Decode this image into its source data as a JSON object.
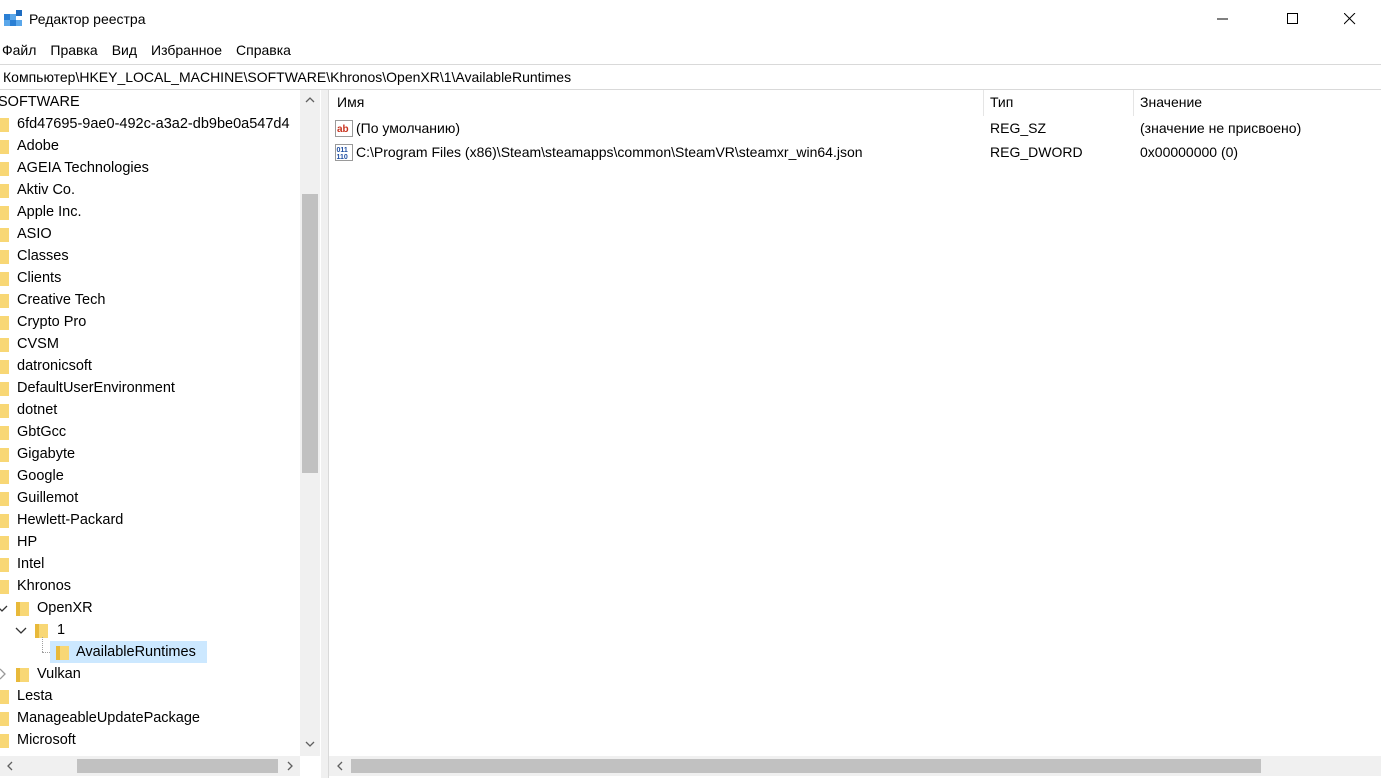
{
  "window": {
    "title": "Редактор реестра",
    "icon": "regedit-icon"
  },
  "menu": [
    "Файл",
    "Правка",
    "Вид",
    "Избранное",
    "Справка"
  ],
  "address": "Компьютер\\HKEY_LOCAL_MACHINE\\SOFTWARE\\Khronos\\OpenXR\\1\\AvailableRuntimes",
  "tree": {
    "root": "SOFTWARE",
    "items": [
      "6fd47695-9ae0-492c-a3a2-db9be0a547d4",
      "Adobe",
      "AGEIA Technologies",
      "Aktiv Co.",
      "Apple Inc.",
      "ASIO",
      "Classes",
      "Clients",
      "Creative Tech",
      "Crypto Pro",
      "CVSM",
      "datronicsoft",
      "DefaultUserEnvironment",
      "dotnet",
      "GbtGcc",
      "Gigabyte",
      "Google",
      "Guillemot",
      "Hewlett-Packard",
      "HP",
      "Intel",
      "Khronos"
    ],
    "khronos_children": {
      "openxr": "OpenXR",
      "openxr_1": "1",
      "selected": "AvailableRuntimes",
      "vulkan": "Vulkan"
    },
    "after": [
      "Lesta",
      "ManageableUpdatePackage",
      "Microsoft"
    ]
  },
  "list": {
    "columns": {
      "name": "Имя",
      "type": "Тип",
      "value": "Значение"
    },
    "rows": [
      {
        "icon": "string-value-icon",
        "name": "(По умолчанию)",
        "type": "REG_SZ",
        "value": "(значение не присвоено)"
      },
      {
        "icon": "binary-value-icon",
        "name": "C:\\Program Files (x86)\\Steam\\steamapps\\common\\SteamVR\\steamxr_win64.json",
        "type": "REG_DWORD",
        "value": "0x00000000 (0)"
      }
    ]
  },
  "colors": {
    "selection": "#cce8ff",
    "folder": "#f8d775",
    "scrollbar_track": "#f0f0f0",
    "scrollbar_thumb": "#c1c1c1"
  }
}
